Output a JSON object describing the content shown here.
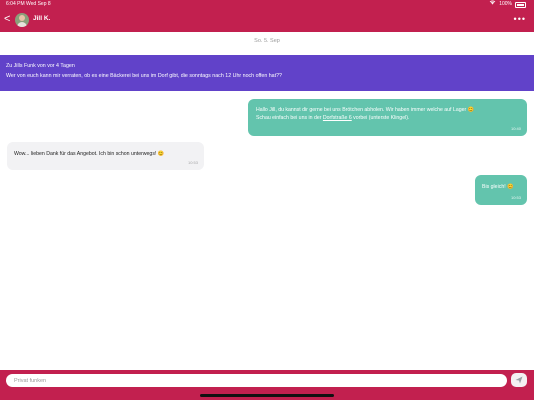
{
  "status_bar": {
    "time": "6:04 PM",
    "date": "Wed Sep 8",
    "battery": "100%"
  },
  "header": {
    "back_label": "<",
    "contact_name": "Jill K.",
    "more_label": "•••"
  },
  "date_divider": "So. 5. Sep",
  "banner": {
    "title": "Zu Jills Funk von vor 4 Tagen",
    "message": "Wer von euch kann mir verraten, ob es eine Bäckerei bei uns im Dorf gibt, die sonntags nach 12 Uhr noch offen hat??"
  },
  "messages": [
    {
      "direction": "outgoing",
      "line1": "Hallo Jill, du kannst dir gerne bei uns Brötchen abholen. Wir haben immer welche auf Lager 😊",
      "line2_before": "Schau einfach bei uns in der ",
      "line2_link": "Dorfstraße 6",
      "line2_after": " vorbei (unterste Klingel).",
      "time": "10:40"
    },
    {
      "direction": "incoming",
      "text": "Wow... lieben Dank für das Angebot. Ich bin schon unterwegs! 😊",
      "time": "10:53"
    },
    {
      "direction": "outgoing",
      "text": "Bis gleich! 😊",
      "time": "10:53"
    }
  ],
  "composer": {
    "placeholder": "Privat funken",
    "send_icon": "send-icon"
  },
  "colors": {
    "brand": "#c2204f",
    "banner": "#6142c9",
    "outgoing_bubble": "#63c4ad",
    "incoming_bubble": "#f2f2f4"
  }
}
